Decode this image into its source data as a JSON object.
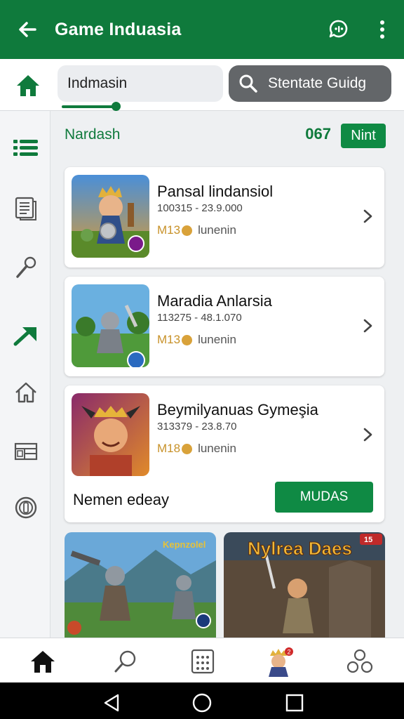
{
  "app_bar": {
    "title": "Game Induasia",
    "back_icon": "arrow-left-icon",
    "actions": [
      "chat-icon",
      "more-vert-icon"
    ]
  },
  "search": {
    "query": "Indmasin",
    "button_label": "Stentate Guidg"
  },
  "rail": {
    "items": [
      "list-icon",
      "document-icon",
      "microphone-icon",
      "trending-icon",
      "home-icon",
      "layout-icon",
      "badge-icon"
    ],
    "active": "trending-icon"
  },
  "section": {
    "title": "Nardash",
    "count": "067",
    "next_label": "Nint"
  },
  "games": [
    {
      "title": "Pansal lindansiol",
      "meta": "100315 - 23.9.000",
      "price": "M13",
      "price_suffix": "lunenin"
    },
    {
      "title": "Maradia Anlarsia",
      "meta": "113275 - 48.1.070",
      "price": "M13",
      "price_suffix": "lunenin",
      "thumb_title": "Kepnzolel"
    },
    {
      "title": "Beymilyanuas Gymeşia",
      "meta": "313379 - 23.8.70",
      "price": "M18",
      "price_suffix": "lunenin",
      "footer_text": "Nemen edeay",
      "action_label": "MUDAS"
    }
  ],
  "tiles": [
    {
      "title": "Kepnzolel"
    },
    {
      "title": "Nylrea Daes",
      "badge": "15"
    }
  ],
  "bottom_nav": {
    "items": [
      "home-icon",
      "search-icon",
      "apps-grid-icon",
      "game-avatar-icon",
      "people-icon"
    ],
    "active": "home-icon",
    "notification_badge": "2"
  },
  "system_nav": [
    "back-triangle-icon",
    "home-circle-icon",
    "recents-square-icon"
  ],
  "colors": {
    "primary": "#0f7a3c",
    "accent_button": "#0f8a44",
    "search_button": "#636669",
    "background": "#eef0f2"
  }
}
